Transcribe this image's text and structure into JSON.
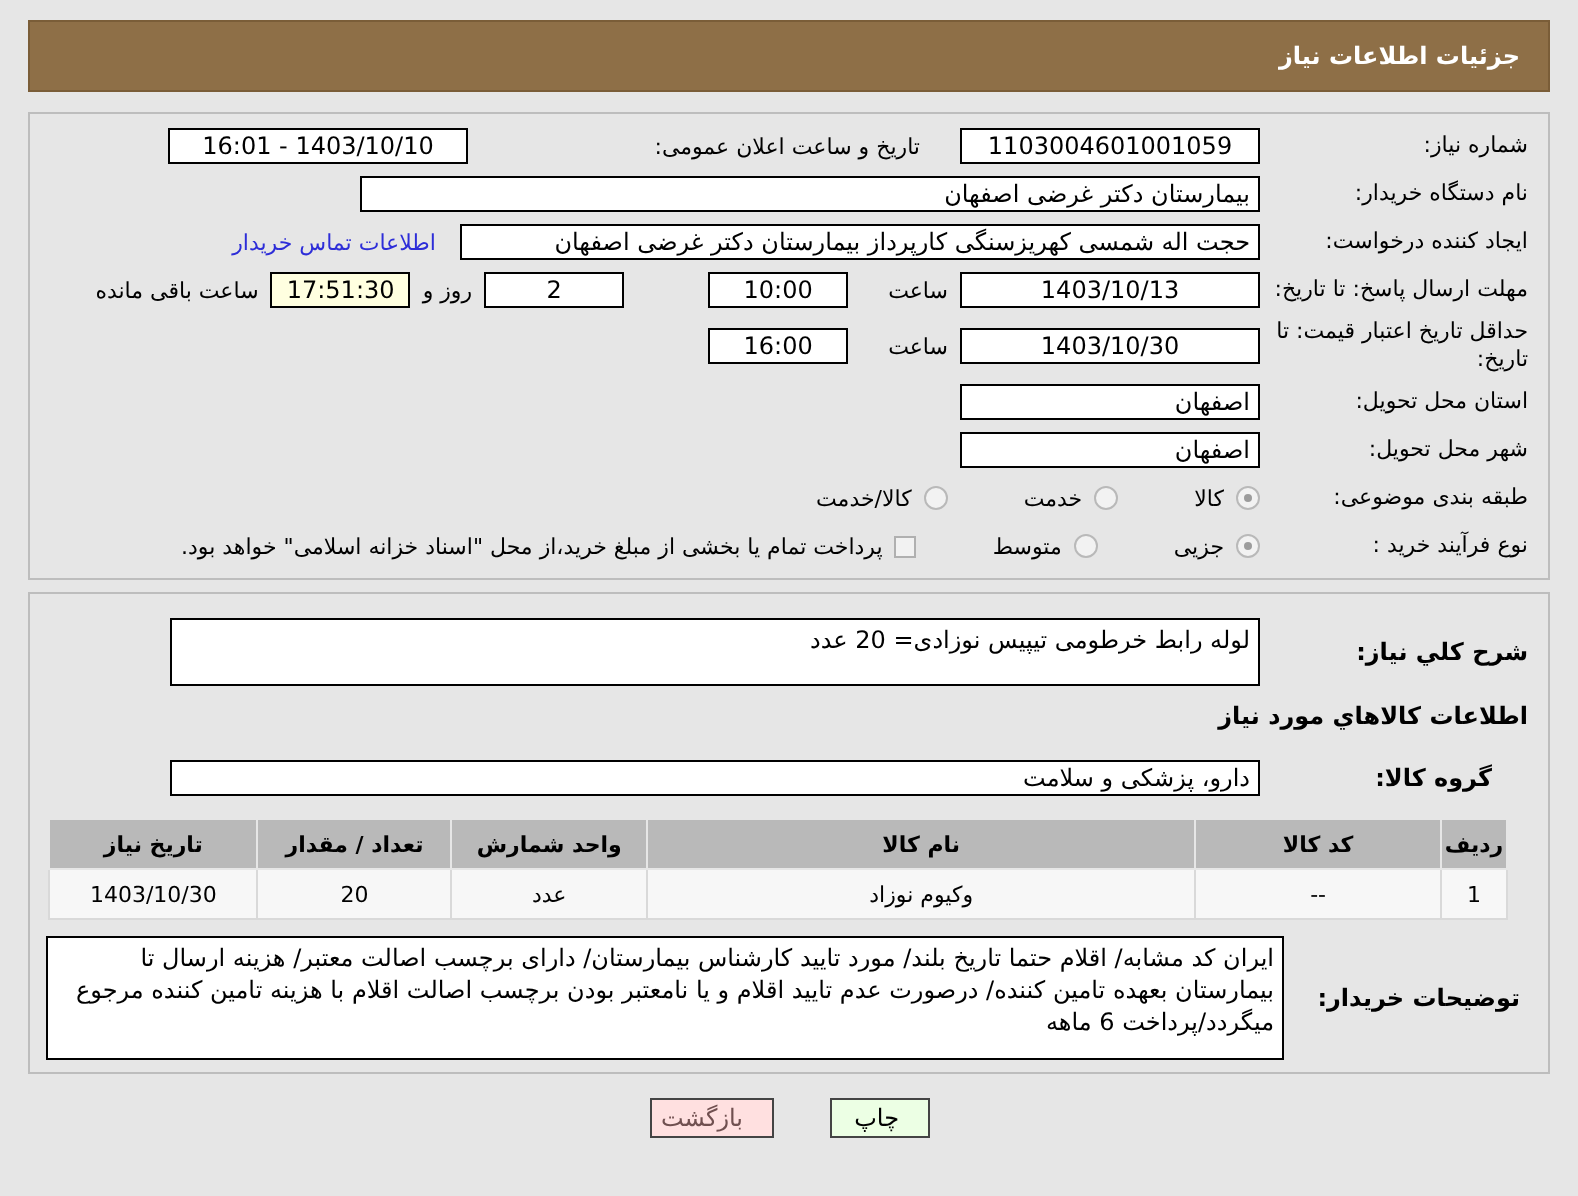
{
  "header": {
    "title": "جزئیات اطلاعات نیاز"
  },
  "need_number": {
    "label": "شماره نیاز:",
    "value": "1103004601001059"
  },
  "announce": {
    "label": "تاریخ و ساعت اعلان عمومی:",
    "value": "1403/10/10 - 16:01"
  },
  "buyer_org": {
    "label": "نام دستگاه خریدار:",
    "value": "بیمارستان دکتر غرضی اصفهان"
  },
  "requester": {
    "label": "ایجاد کننده درخواست:",
    "value": "حجت اله شمسی کهریزسنگی کارپرداز بیمارستان دکتر غرضی اصفهان",
    "link": "اطلاعات تماس خریدار"
  },
  "response_deadline": {
    "label": "مهلت ارسال پاسخ: تا تاریخ:",
    "date": "1403/10/13",
    "time_label": "ساعت",
    "time": "10:00",
    "days": "2",
    "days_label": "روز و",
    "remaining": "17:51:30",
    "remaining_label": "ساعت باقی مانده"
  },
  "price_validity": {
    "label": "حداقل تاریخ اعتبار قیمت: تا تاریخ:",
    "date": "1403/10/30",
    "time_label": "ساعت",
    "time": "16:00"
  },
  "province": {
    "label": "استان محل تحویل:",
    "value": "اصفهان"
  },
  "city": {
    "label": "شهر محل تحویل:",
    "value": "اصفهان"
  },
  "category": {
    "label": "طبقه بندی موضوعی:",
    "options": [
      {
        "label": "کالا",
        "selected": true
      },
      {
        "label": "خدمت",
        "selected": false
      },
      {
        "label": "کالا/خدمت",
        "selected": false
      }
    ]
  },
  "process": {
    "label": "نوع فرآیند خرید :",
    "options": [
      {
        "label": "جزیی",
        "selected": true
      },
      {
        "label": "متوسط",
        "selected": false
      }
    ],
    "checkbox": {
      "label": "پرداخت تمام یا بخشی از مبلغ خرید،از محل \"اسناد خزانه اسلامی\" خواهد بود.",
      "checked": false
    }
  },
  "description": {
    "label": "شرح کلي نياز:",
    "value": "لوله رابط خرطومی تیپیس نوزادی= 20 عدد"
  },
  "goods_title": "اطلاعات کالاهاي مورد نياز",
  "goods_group": {
    "label": "گروه کالا:",
    "value": "دارو، پزشکی و سلامت"
  },
  "table": {
    "columns": [
      "ردیف",
      "کد کالا",
      "نام کالا",
      "واحد شمارش",
      "تعداد / مقدار",
      "تاریخ نیاز"
    ],
    "rows": [
      [
        "1",
        "--",
        "وکیوم نوزاد",
        "عدد",
        "20",
        "1403/10/30"
      ]
    ]
  },
  "buyer_notes": {
    "label": "توضیحات خریدار:",
    "value": "ایران کد مشابه/ اقلام حتما تاریخ بلند/ مورد تایید کارشناس بیمارستان/ دارای برچسب اصالت معتبر/ هزینه ارسال تا بیمارستان بعهده تامین کننده/ درصورت عدم تایید اقلام و یا نامعتبر بودن برچسب اصالت اقلام با هزینه تامین کننده مرجوع میگردد/پرداخت 6 ماهه"
  },
  "buttons": [
    {
      "label": "چاپ",
      "kind": "print"
    },
    {
      "label": "بازگشت",
      "kind": "back"
    }
  ]
}
